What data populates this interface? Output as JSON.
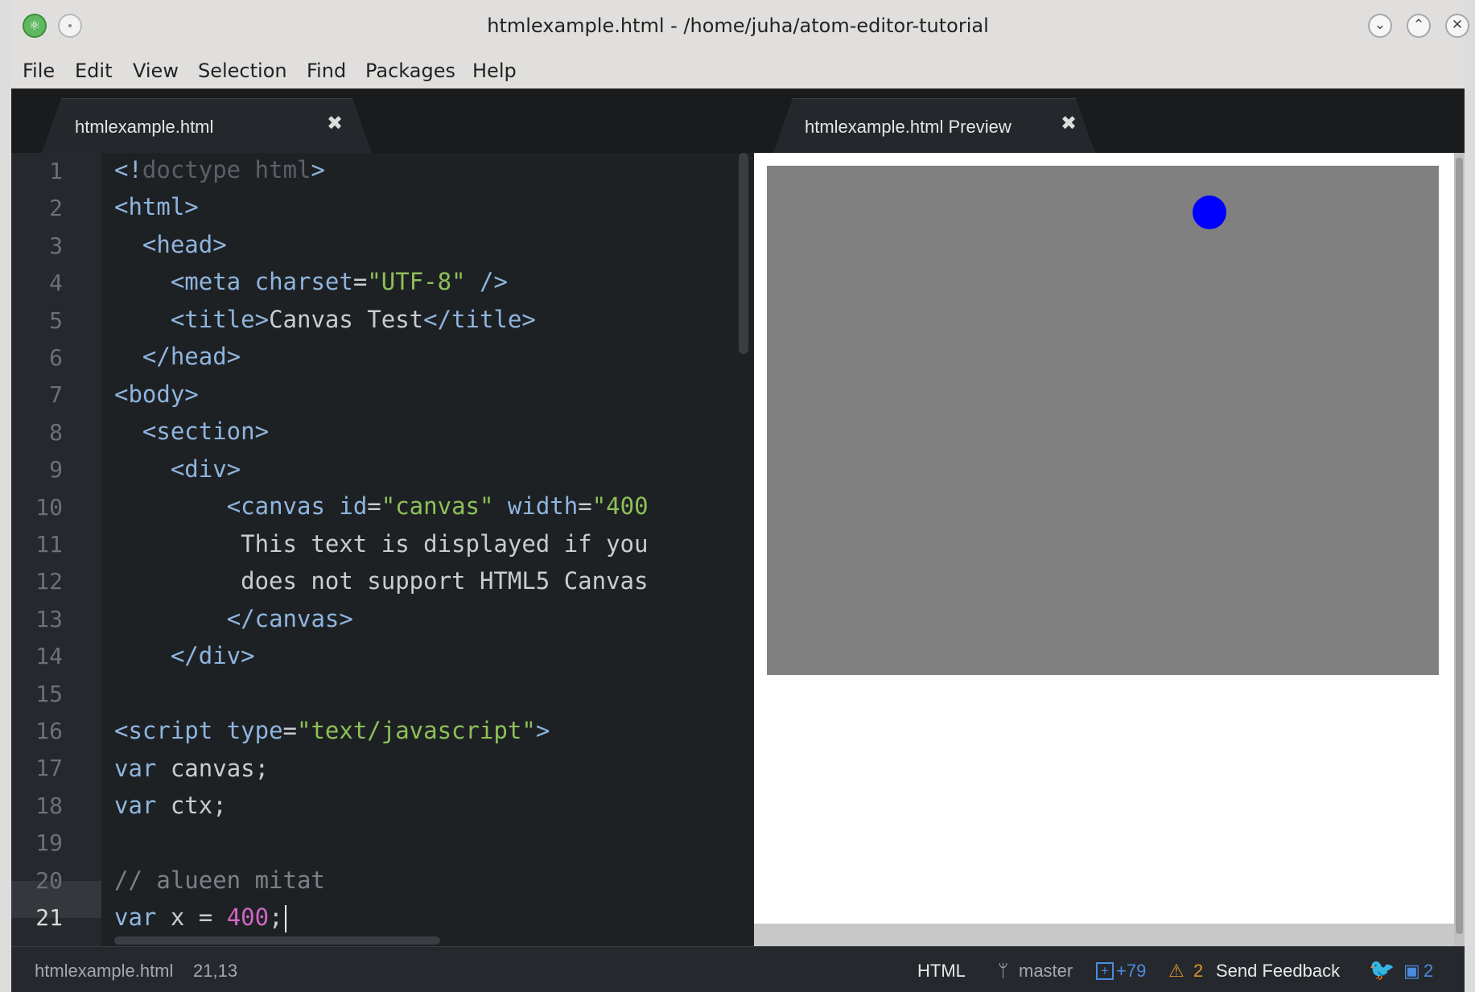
{
  "window": {
    "title": "htmlexample.html - /home/juha/atom-editor-tutorial"
  },
  "menu": [
    "File",
    "Edit",
    "View",
    "Selection",
    "Find",
    "Packages",
    "Help"
  ],
  "tabs": [
    {
      "label": "htmlexample.html",
      "close": "✖"
    },
    {
      "label": "htmlexample.html Preview",
      "close": "✖"
    }
  ],
  "code_lines": [
    "<!doctype html>",
    "<html>",
    "  <head>",
    "    <meta charset=\"UTF-8\" />",
    "    <title>Canvas Test</title>",
    "  </head>",
    "<body>",
    "  <section>",
    "    <div>",
    "        <canvas id=\"canvas\" width=\"400",
    "         This text is displayed if you",
    "         does not support HTML5 Canvas",
    "        </canvas>",
    "    </div>",
    "",
    "<script type=\"text/javascript\">",
    "var canvas;",
    "var ctx;",
    "",
    "// alueen mitat",
    "var x = 400;"
  ],
  "line_numbers": [
    "1",
    "2",
    "3",
    "4",
    "5",
    "6",
    "7",
    "8",
    "9",
    "10",
    "11",
    "12",
    "13",
    "14",
    "15",
    "16",
    "17",
    "18",
    "19",
    "20",
    "21"
  ],
  "current_line": 21,
  "preview": {
    "canvas_color": "#808080",
    "ball_color": "#0000ff"
  },
  "status": {
    "file": "htmlexample.html",
    "position": "21,13",
    "grammar": "HTML",
    "branch": "master",
    "git_added": "+79",
    "warnings": "2",
    "feedback": "Send Feedback",
    "packages": "2"
  },
  "colors": {
    "accent_blue": "#4b8be0",
    "warning_orange": "#e0912b"
  }
}
